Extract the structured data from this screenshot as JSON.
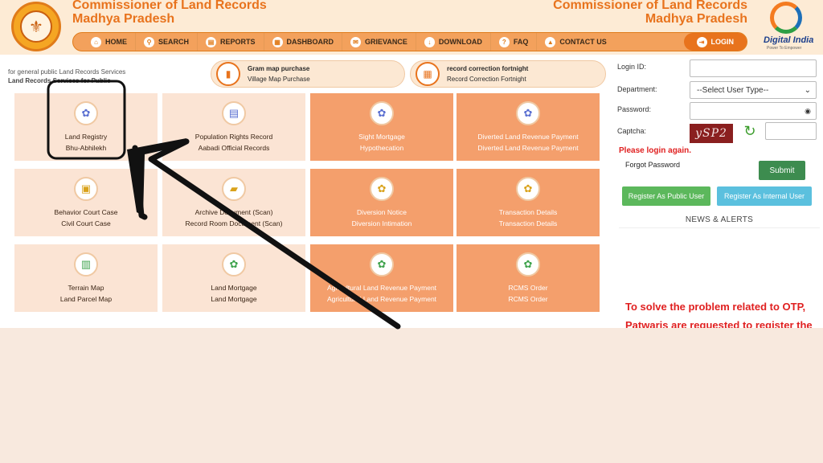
{
  "header": {
    "title_left_line1": "Commissioner of Land Records",
    "title_left_line2": "Madhya Pradesh",
    "title_right_line1": "Commissioner of Land Records",
    "title_right_line2": "Madhya Pradesh",
    "digital_india": "Digital India",
    "digital_india_tagline": "Power To Empower"
  },
  "nav": {
    "items": [
      {
        "label": "HOME",
        "icon": "home-icon",
        "glyph": "⌂"
      },
      {
        "label": "SEARCH",
        "icon": "search-icon",
        "glyph": "⚲"
      },
      {
        "label": "REPORTS",
        "icon": "report-icon",
        "glyph": "▤"
      },
      {
        "label": "DASHBOARD",
        "icon": "dashboard-icon",
        "glyph": "▦"
      },
      {
        "label": "GRIEVANCE",
        "icon": "grievance-icon",
        "glyph": "✉"
      },
      {
        "label": "DOWNLOAD",
        "icon": "download-icon",
        "glyph": "↓"
      },
      {
        "label": "FAQ",
        "icon": "faq-icon",
        "glyph": "?"
      },
      {
        "label": "CONTACT US",
        "icon": "contact-icon",
        "glyph": "▲"
      }
    ],
    "login": "LOGIN"
  },
  "info": {
    "line1": "for general public Land Records Services",
    "line2": "Land Records Services for Public"
  },
  "pills": [
    {
      "title": "Gram map purchase",
      "subtitle": "Village Map Purchase"
    },
    {
      "title": "record correction fortnight",
      "subtitle": "Record Correction Fortnight"
    }
  ],
  "tiles": [
    {
      "line1": "Land Registry",
      "line2": "Bhu-Abhilekh",
      "style": "light",
      "icon": "registry-icon",
      "glyph": "✿",
      "color": "#5a6fd1"
    },
    {
      "line1": "Population Rights Record",
      "line2": "Aabadi Official Records",
      "style": "light",
      "icon": "population-record-icon",
      "glyph": "▤",
      "color": "#5a6fd1"
    },
    {
      "line1": "Sight Mortgage",
      "line2": "Hypothecation",
      "style": "dark",
      "icon": "mortgage-icon",
      "glyph": "✿",
      "color": "#5a6fd1"
    },
    {
      "line1": "Diverted Land Revenue Payment",
      "line2": "Diverted Land Revenue Payment",
      "style": "dark",
      "icon": "payment-icon",
      "glyph": "✿",
      "color": "#5a6fd1"
    },
    {
      "line1": "Behavior Court Case",
      "line2": "Civil Court Case",
      "style": "light",
      "icon": "court-case-icon",
      "glyph": "▣",
      "color": "#d9a21b"
    },
    {
      "line1": "Archive Document (Scan)",
      "line2": "Record Room Document (Scan)",
      "style": "light",
      "icon": "archive-icon",
      "glyph": "▰",
      "color": "#d9a21b"
    },
    {
      "line1": "Diversion Notice",
      "line2": "Diversion Intimation",
      "style": "dark",
      "icon": "diversion-icon",
      "glyph": "✿",
      "color": "#d9a21b"
    },
    {
      "line1": "Transaction Details",
      "line2": "Transaction Details",
      "style": "dark",
      "icon": "transaction-icon",
      "glyph": "✿",
      "color": "#d9a21b"
    },
    {
      "line1": "Terrain Map",
      "line2": "Land Parcel Map",
      "style": "light",
      "icon": "map-icon",
      "glyph": "▥",
      "color": "#3fa34d"
    },
    {
      "line1": "Land Mortgage",
      "line2": "Land Mortgage",
      "style": "light",
      "icon": "land-mortgage-icon",
      "glyph": "✿",
      "color": "#3fa34d"
    },
    {
      "line1": "Agricultural Land Revenue Payment",
      "line2": "Agricultural Land Revenue Payment",
      "style": "dark",
      "icon": "agri-payment-icon",
      "glyph": "✿",
      "color": "#3fa34d"
    },
    {
      "line1": "RCMS Order",
      "line2": "RCMS Order",
      "style": "dark",
      "icon": "rcms-icon",
      "glyph": "✿",
      "color": "#3fa34d"
    }
  ],
  "login": {
    "login_id_label": "Login ID:",
    "login_id_value": "",
    "department_label": "Department:",
    "department_value": "--Select User Type--",
    "password_label": "Password:",
    "password_value": "",
    "captcha_label": "Captcha:",
    "captcha_text": "ySP2",
    "captcha_value": "",
    "error": "Please login again.",
    "forgot": "Forgot Password",
    "submit": "Submit",
    "register_public": "Register As Public User",
    "register_internal": "Register As Internal User"
  },
  "news": {
    "heading": "NEWS & ALERTS",
    "line1": "To solve the problem related to OTP,",
    "line2": "Patwaris are requested to register the"
  },
  "colors": {
    "accent": "#e8731d",
    "tile_light": "#fbe4d4",
    "tile_dark": "#f49f6c",
    "error": "#e02020",
    "submit": "#3d8c4f",
    "register_public": "#5cb85c",
    "register_internal": "#5bc0de"
  }
}
